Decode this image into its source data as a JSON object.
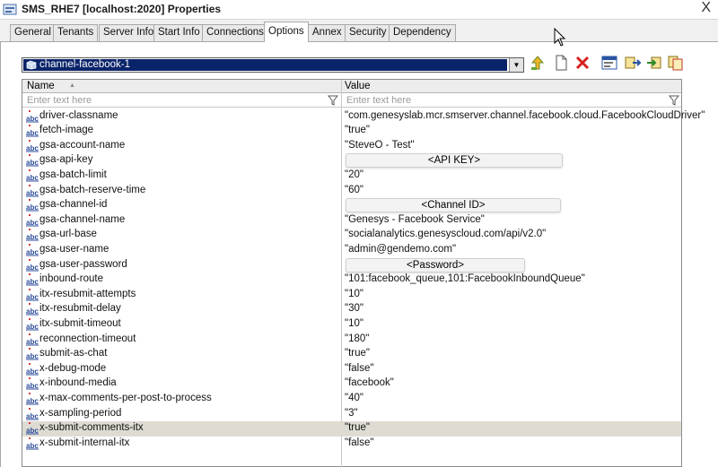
{
  "window": {
    "title": "SMS_RHE7 [localhost:2020] Properties",
    "close_glyph": "X"
  },
  "tabs": [
    {
      "label": "General"
    },
    {
      "label": "Tenants"
    },
    {
      "label": "Server Info"
    },
    {
      "label": "Start Info"
    },
    {
      "label": "Connections"
    },
    {
      "label": "Options",
      "active": true
    },
    {
      "label": "Annex"
    },
    {
      "label": "Security"
    },
    {
      "label": "Dependency"
    }
  ],
  "section_select": {
    "value": "channel-facebook-1",
    "icon": "section-folder-icon"
  },
  "toolbar": {
    "icons": [
      "upload-arrow-icon",
      "new-document-icon",
      "delete-x-icon",
      "edit-properties-icon",
      "export-icon",
      "import-icon",
      "copy-icon"
    ]
  },
  "grid": {
    "columns": {
      "name": "Name",
      "value": "Value"
    },
    "filter_placeholder": "Enter text here",
    "rows": [
      {
        "name": "driver-classname",
        "value": "\"com.genesyslab.mcr.smserver.channel.facebook.cloud.FacebookCloudDriver\""
      },
      {
        "name": "fetch-image",
        "value": "\"true\""
      },
      {
        "name": "gsa-account-name",
        "value": "\"SteveO - Test\""
      },
      {
        "name": "gsa-api-key",
        "value": "",
        "redacted": "<API KEY>"
      },
      {
        "name": "gsa-batch-limit",
        "value": "\"20\""
      },
      {
        "name": "gsa-batch-reserve-time",
        "value": "\"60\""
      },
      {
        "name": "gsa-channel-id",
        "value": "",
        "redacted": "<Channel ID>"
      },
      {
        "name": "gsa-channel-name",
        "value": "\"Genesys - Facebook Service\""
      },
      {
        "name": "gsa-url-base",
        "value": "\"socialanalytics.genesyscloud.com/api/v2.0\""
      },
      {
        "name": "gsa-user-name",
        "value": "\"admin@gendemo.com\""
      },
      {
        "name": "gsa-user-password",
        "value": "",
        "redacted": "<Password>"
      },
      {
        "name": "inbound-route",
        "value": "\"101:facebook_queue,101:FacebookInboundQueue\""
      },
      {
        "name": "itx-resubmit-attempts",
        "value": "\"10\""
      },
      {
        "name": "itx-resubmit-delay",
        "value": "\"30\""
      },
      {
        "name": "itx-submit-timeout",
        "value": "\"10\""
      },
      {
        "name": "reconnection-timeout",
        "value": "\"180\""
      },
      {
        "name": "submit-as-chat",
        "value": "\"true\""
      },
      {
        "name": "x-debug-mode",
        "value": "\"false\""
      },
      {
        "name": "x-inbound-media",
        "value": "\"facebook\""
      },
      {
        "name": "x-max-comments-per-post-to-process",
        "value": "\"40\""
      },
      {
        "name": "x-sampling-period",
        "value": "\"3\""
      },
      {
        "name": "x-submit-comments-itx",
        "value": "\"true\"",
        "selected": true
      },
      {
        "name": "x-submit-internal-itx",
        "value": "\"false\""
      }
    ]
  },
  "colors": {
    "selection": "#0a246a",
    "row_highlight": "#dedbd2",
    "tab_border": "#a9a9a9"
  }
}
